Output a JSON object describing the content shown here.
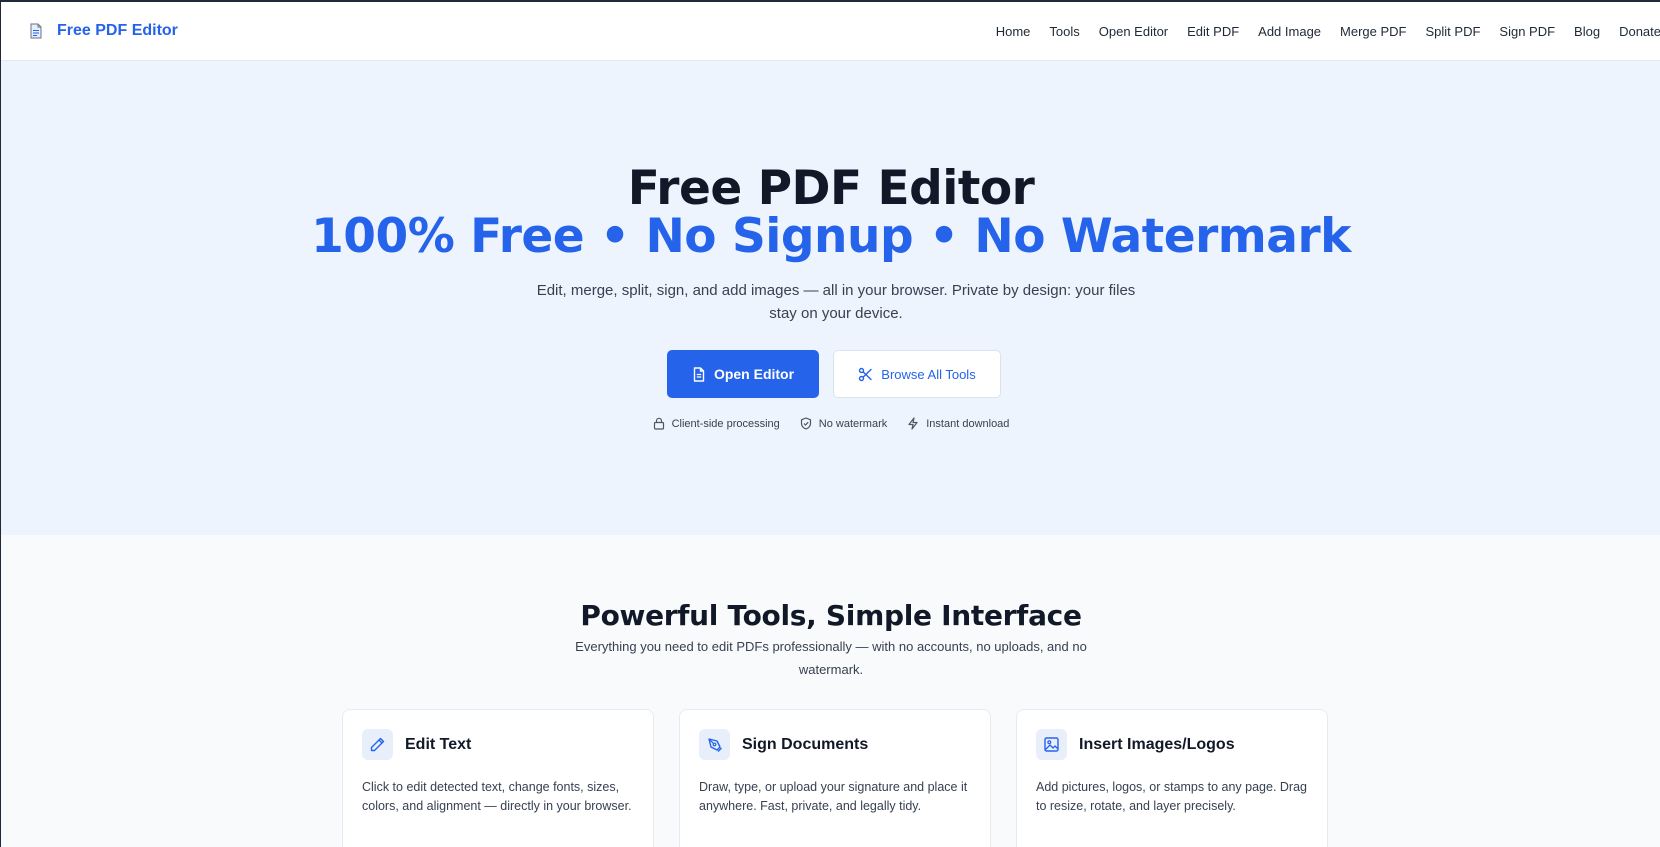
{
  "header": {
    "brand": "Free PDF Editor",
    "nav": [
      "Home",
      "Tools",
      "Open Editor",
      "Edit PDF",
      "Add Image",
      "Merge PDF",
      "Split PDF",
      "Sign PDF",
      "Blog",
      "Donate"
    ]
  },
  "hero": {
    "title": "Free PDF Editor",
    "subtitle": "100% Free • No Signup • No Watermark",
    "description": "Edit, merge, split, sign, and add images — all in your browser. Private by design: your files stay on your device.",
    "primary_button": "Open Editor",
    "secondary_button": "Browse All Tools",
    "badges": [
      "Client-side processing",
      "No watermark",
      "Instant download"
    ]
  },
  "features": {
    "title": "Powerful Tools, Simple Interface",
    "description": "Everything you need to edit PDFs professionally — with no accounts, no uploads, and no watermark.",
    "cards": [
      {
        "title": "Edit Text",
        "text": "Click to edit detected text, change fonts, sizes, colors, and alignment — directly in your browser.",
        "icon": "pencil-icon"
      },
      {
        "title": "Sign Documents",
        "text": "Draw, type, or upload your signature and place it anywhere. Fast, private, and legally tidy.",
        "icon": "pen-nib-icon"
      },
      {
        "title": "Insert Images/Logos",
        "text": "Add pictures, logos, or stamps to any page. Drag to resize, rotate, and layer precisely.",
        "icon": "image-icon"
      }
    ]
  },
  "colors": {
    "accent": "#2563eb",
    "hero_bg": "#eef4fd",
    "page_bg": "#f8fafc"
  }
}
